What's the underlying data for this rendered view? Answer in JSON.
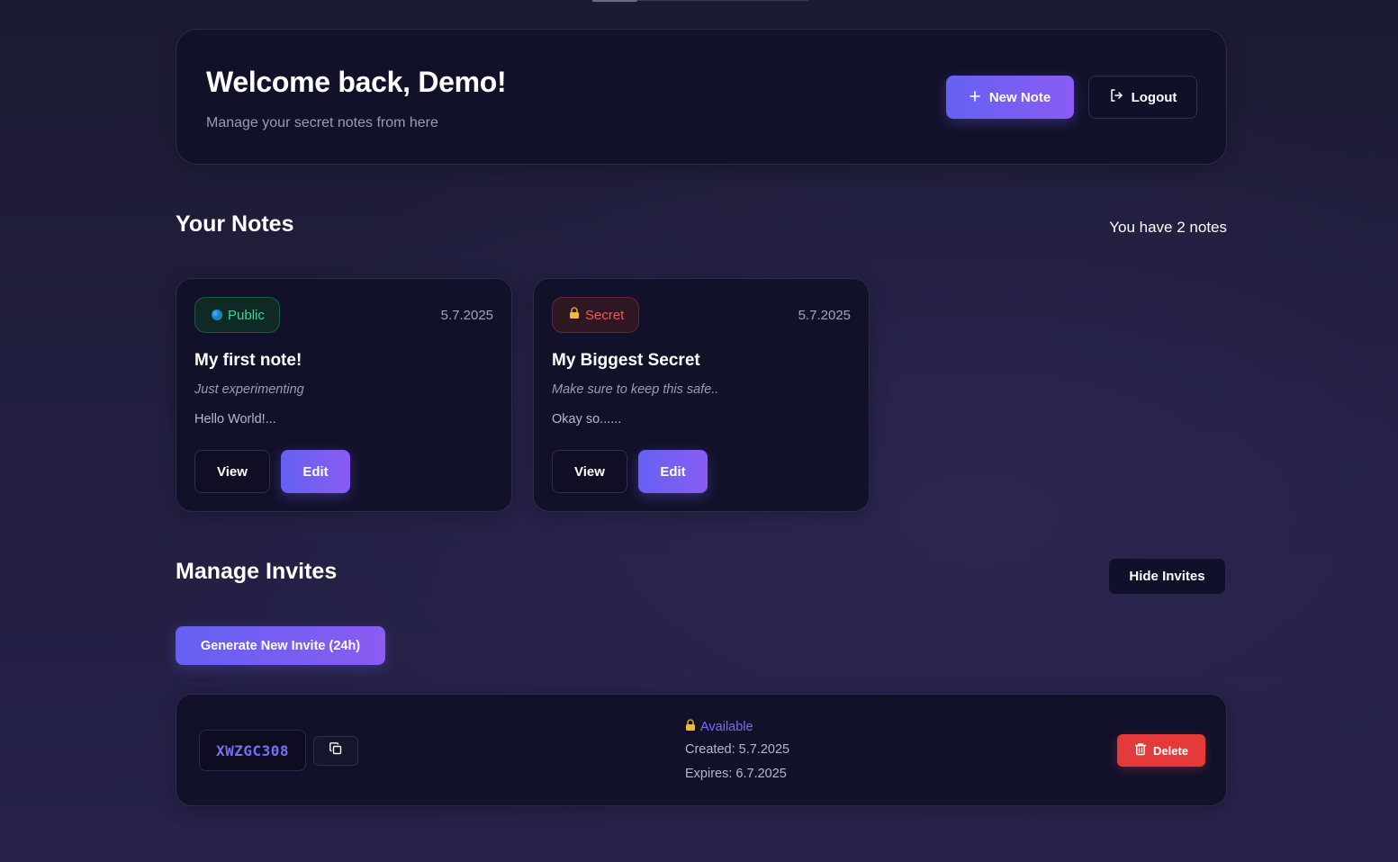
{
  "header": {
    "welcome": "Welcome back, Demo!",
    "subtitle": "Manage your secret notes from here",
    "new_note_label": "New Note",
    "logout_label": "Logout"
  },
  "notes_section": {
    "title": "Your Notes",
    "count_text": "You have 2 notes",
    "notes": [
      {
        "visibility": "Public",
        "date": "5.7.2025",
        "title": "My first note!",
        "description": "Just experimenting",
        "preview": "Hello World!...",
        "view_label": "View",
        "edit_label": "Edit"
      },
      {
        "visibility": "Secret",
        "date": "5.7.2025",
        "title": "My Biggest Secret",
        "description": "Make sure to keep this safe..",
        "preview": "Okay so......",
        "view_label": "View",
        "edit_label": "Edit"
      }
    ]
  },
  "invites_section": {
    "title": "Manage Invites",
    "hide_label": "Hide Invites",
    "generate_label": "Generate New Invite (24h)",
    "invites": [
      {
        "code": "XWZGC308",
        "status": "Available",
        "created": "Created: 5.7.2025",
        "expires": "Expires: 6.7.2025",
        "delete_label": "Delete"
      }
    ]
  },
  "colors": {
    "accent": "#6461f2",
    "accent_end": "#8a5cf2",
    "public": "#3ed39a",
    "secret": "#ef5a5a",
    "danger": "#e43a3a",
    "card_bg": "#12112a"
  },
  "icons": {
    "new_note": "plus-icon",
    "logout": "logout-icon",
    "public": "globe-icon",
    "secret": "lock-icon",
    "copy": "copy-icon",
    "delete": "trash-icon"
  }
}
